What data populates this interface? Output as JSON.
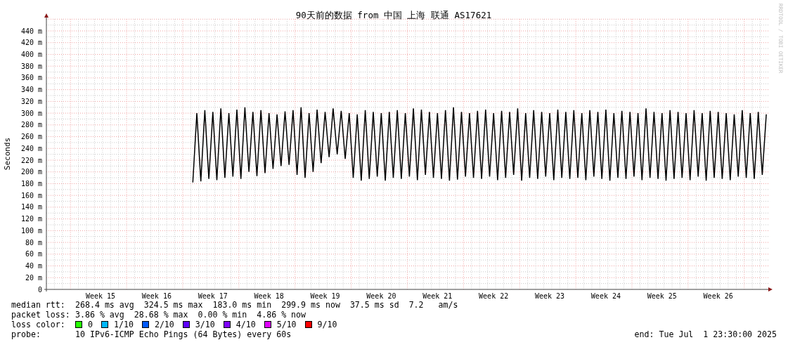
{
  "graph": {
    "watermark": "RRDTOOL / TOBI OETIKER",
    "chart_data": {
      "type": "line",
      "grid": true,
      "title": "90天前的数据 from 中国 上海 联通 AS17621",
      "ylabel": "Seconds",
      "ylim": [
        0,
        460
      ],
      "categories": [
        null,
        null,
        null,
        null,
        null,
        null,
        null,
        null,
        null,
        null,
        null,
        null,
        null,
        "Week 15",
        null,
        null,
        null,
        null,
        null,
        null,
        null,
        null,
        null,
        null,
        null,
        null,
        null,
        "Week 16",
        null,
        null,
        null,
        null,
        null,
        null,
        null,
        null,
        null,
        null,
        null,
        null,
        null,
        "Week 17",
        null,
        null,
        null,
        null,
        null,
        null,
        null,
        null,
        null,
        null,
        null,
        null,
        null,
        "Week 18",
        null,
        null,
        null,
        null,
        null,
        null,
        null,
        null,
        null,
        null,
        null,
        null,
        null,
        "Week 19",
        null,
        null,
        null,
        null,
        null,
        null,
        null,
        null,
        null,
        null,
        null,
        null,
        null,
        "Week 20",
        null,
        null,
        null,
        null,
        null,
        null,
        null,
        null,
        null,
        null,
        null,
        null,
        null,
        "Week 21",
        null,
        null,
        null,
        null,
        null,
        null,
        null,
        null,
        null,
        null,
        null,
        null,
        null,
        "Week 22",
        null,
        null,
        null,
        null,
        null,
        null,
        null,
        null,
        null,
        null,
        null,
        null,
        null,
        "Week 23",
        null,
        null,
        null,
        null,
        null,
        null,
        null,
        null,
        null,
        null,
        null,
        null,
        null,
        "Week 24",
        null,
        null,
        null,
        null,
        null,
        null,
        null,
        null,
        null,
        null,
        null,
        null,
        null,
        "Week 25",
        null,
        null,
        null,
        null,
        null,
        null,
        null,
        null,
        null,
        null,
        null,
        null,
        null,
        "Week 26",
        null,
        null,
        null,
        null,
        null,
        null,
        null,
        null,
        null,
        null,
        null,
        null
      ],
      "yticks": [
        {
          "value": 0,
          "label": "0"
        },
        {
          "value": 20,
          "label": "20 m"
        },
        {
          "value": 40,
          "label": "40 m"
        },
        {
          "value": 60,
          "label": "60 m"
        },
        {
          "value": 80,
          "label": "80 m"
        },
        {
          "value": 100,
          "label": "100 m"
        },
        {
          "value": 120,
          "label": "120 m"
        },
        {
          "value": 140,
          "label": "140 m"
        },
        {
          "value": 160,
          "label": "160 m"
        },
        {
          "value": 180,
          "label": "180 m"
        },
        {
          "value": 200,
          "label": "200 m"
        },
        {
          "value": 220,
          "label": "220 m"
        },
        {
          "value": 240,
          "label": "240 m"
        },
        {
          "value": 260,
          "label": "260 m"
        },
        {
          "value": 280,
          "label": "280 m"
        },
        {
          "value": 300,
          "label": "300 m"
        },
        {
          "value": 320,
          "label": "320 m"
        },
        {
          "value": 340,
          "label": "340 m"
        },
        {
          "value": 360,
          "label": "360 m"
        },
        {
          "value": 380,
          "label": "380 m"
        },
        {
          "value": 400,
          "label": "400 m"
        },
        {
          "value": 420,
          "label": "420 m"
        },
        {
          "value": 440,
          "label": "440 m"
        }
      ],
      "series": [
        {
          "color": "#000000",
          "values": [
            null,
            null,
            null,
            null,
            null,
            null,
            null,
            null,
            null,
            null,
            null,
            null,
            null,
            null,
            null,
            null,
            null,
            null,
            null,
            null,
            null,
            null,
            null,
            null,
            null,
            null,
            null,
            null,
            null,
            null,
            null,
            null,
            null,
            null,
            null,
            null,
            182,
            300,
            184,
            305,
            188,
            302,
            186,
            308,
            190,
            300,
            192,
            306,
            188,
            310,
            200,
            302,
            193,
            305,
            198,
            300,
            205,
            298,
            210,
            303,
            212,
            305,
            195,
            310,
            190,
            300,
            200,
            306,
            215,
            302,
            225,
            308,
            230,
            304,
            222,
            300,
            190,
            298,
            185,
            305,
            188,
            302,
            192,
            300,
            185,
            302,
            190,
            305,
            188,
            300,
            192,
            308,
            186,
            306,
            195,
            302,
            190,
            300,
            188,
            305,
            185,
            310,
            187,
            302,
            192,
            300,
            190,
            304,
            188,
            306,
            192,
            300,
            186,
            304,
            190,
            302,
            195,
            308,
            185,
            300,
            190,
            305,
            188,
            302,
            192,
            300,
            186,
            306,
            190,
            302,
            188,
            305,
            190,
            300,
            186,
            305,
            192,
            302,
            188,
            306,
            185,
            300,
            190,
            304,
            188,
            302,
            192,
            300,
            186,
            308,
            190,
            302,
            188,
            300,
            185,
            305,
            188,
            302,
            190,
            300,
            186,
            305,
            192,
            300,
            185,
            304,
            190,
            302,
            188,
            300,
            186,
            298,
            192,
            305,
            190,
            300,
            188,
            302,
            195,
            298
          ]
        }
      ]
    }
  },
  "legend": {
    "stats": [
      {
        "label": "median rtt:",
        "text": "268.4 ms avg  324.5 ms max  183.0 ms min  299.9 ms now  37.5 ms sd  7.2   am/s"
      },
      {
        "label": "packet loss:",
        "text": "3.86 % avg  28.68 % max  0.00 % min  4.86 % now"
      }
    ],
    "loss_color": {
      "label": "loss color:",
      "items": [
        {
          "label": "0",
          "color": "#26ff00"
        },
        {
          "label": "1/10",
          "color": "#00b8ff"
        },
        {
          "label": "2/10",
          "color": "#0059ff"
        },
        {
          "label": "3/10",
          "color": "#5e00ff"
        },
        {
          "label": "4/10",
          "color": "#7e00ff"
        },
        {
          "label": "5/10",
          "color": "#dd00ff"
        },
        {
          "label": "9/10",
          "color": "#ff0000"
        }
      ]
    },
    "probe": {
      "label": "probe:",
      "text": "10 IPv6-ICMP Echo Pings (64 Bytes) every 60s"
    },
    "end": "end: Tue Jul  1 23:30:00 2025"
  }
}
